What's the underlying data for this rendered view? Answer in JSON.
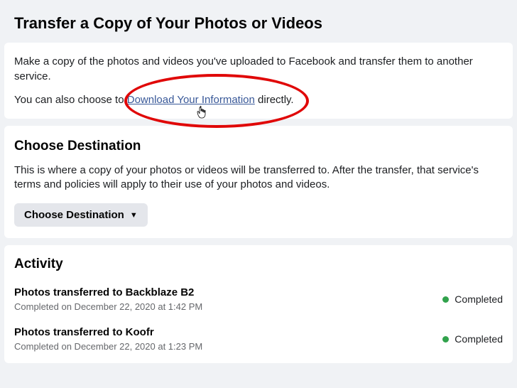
{
  "header": {
    "title": "Transfer a Copy of Your Photos or Videos"
  },
  "intro": {
    "p1": "Make a copy of the photos and videos you've uploaded to Facebook and transfer them to another service.",
    "p2_pre": "You can also choose to ",
    "link": "Download Your Information",
    "p2_post": " directly."
  },
  "destination": {
    "heading": "Choose Destination",
    "text": "This is where a copy of your photos or videos will be transferred to. After the transfer, that service's terms and policies will apply to their use of your photos and videos.",
    "button": "Choose Destination"
  },
  "activity": {
    "heading": "Activity",
    "items": [
      {
        "title": "Photos transferred to Backblaze B2",
        "sub": "Completed on December 22, 2020 at 1:42 PM",
        "status": "Completed"
      },
      {
        "title": "Photos transferred to Koofr",
        "sub": "Completed on December 22, 2020 at 1:23 PM",
        "status": "Completed"
      }
    ]
  },
  "annotation": {
    "color": "#e00707"
  }
}
